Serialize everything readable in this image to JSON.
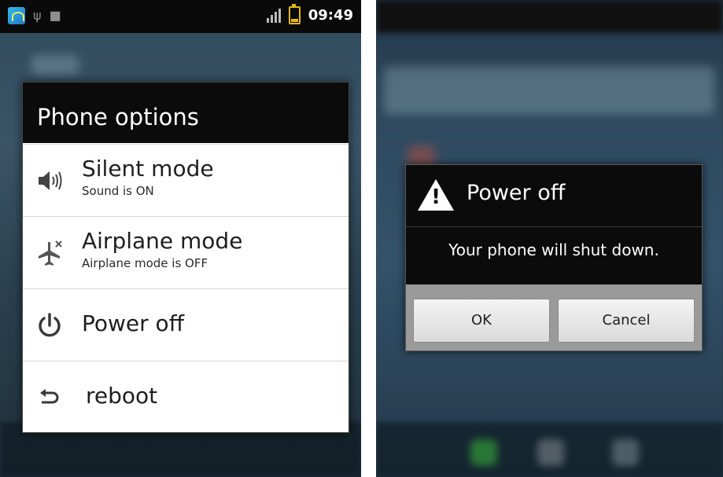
{
  "left": {
    "status_bar": {
      "time": "09:49"
    },
    "dialog": {
      "title": "Phone options",
      "items": [
        {
          "icon": "speaker-icon",
          "title": "Silent mode",
          "subtitle": "Sound is ON"
        },
        {
          "icon": "airplane-icon",
          "title": "Airplane mode",
          "subtitle": "Airplane mode is OFF"
        },
        {
          "icon": "power-icon",
          "title": "Power off"
        },
        {
          "icon": "reboot-icon",
          "title": "reboot"
        }
      ]
    }
  },
  "right": {
    "dialog": {
      "icon": "warning-icon",
      "title": "Power off",
      "message": "Your phone will shut down.",
      "ok_label": "OK",
      "cancel_label": "Cancel"
    }
  },
  "colors": {
    "dialog_header": "#0b0b0b",
    "status_bar": "#0a0a0a",
    "battery": "#e3b814",
    "button_bg": "#e8e8e8"
  }
}
